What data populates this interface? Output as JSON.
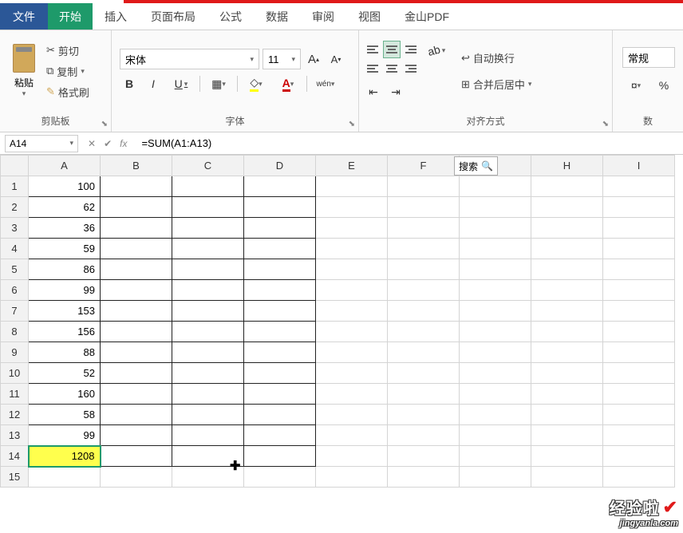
{
  "tabs": {
    "file": "文件",
    "home": "开始",
    "insert": "插入",
    "layout": "页面布局",
    "formulas": "公式",
    "data": "数据",
    "review": "审阅",
    "view": "视图",
    "pdf": "金山PDF"
  },
  "clipboard": {
    "paste": "粘贴",
    "cut": "剪切",
    "copy": "复制",
    "format_painter": "格式刷",
    "group_label": "剪贴板"
  },
  "font": {
    "name": "宋体",
    "size": "11",
    "group_label": "字体",
    "bold": "B",
    "italic": "I",
    "underline": "U",
    "pinyin": "wén",
    "grow_label": "A",
    "shrink_label": "A"
  },
  "alignment": {
    "group_label": "对齐方式",
    "wrap": "自动换行",
    "merge": "合并后居中"
  },
  "number": {
    "format": "常规",
    "percent": "%",
    "group_label": "数"
  },
  "formula_bar": {
    "cell_ref": "A14",
    "cancel": "✕",
    "enter": "✔",
    "fx": "fx",
    "formula": "=SUM(A1:A13)"
  },
  "columns": [
    "A",
    "B",
    "C",
    "D",
    "E",
    "F",
    "",
    "H",
    "I"
  ],
  "search_label": "搜索",
  "rows": [
    "1",
    "2",
    "3",
    "4",
    "5",
    "6",
    "7",
    "8",
    "9",
    "10",
    "11",
    "12",
    "13",
    "14",
    "15"
  ],
  "cells_a": [
    "100",
    "62",
    "36",
    "59",
    "86",
    "99",
    "153",
    "156",
    "88",
    "52",
    "160",
    "58",
    "99"
  ],
  "active_value": "1208",
  "watermark": {
    "title": "经验啦",
    "url": "jingyanla.com"
  }
}
